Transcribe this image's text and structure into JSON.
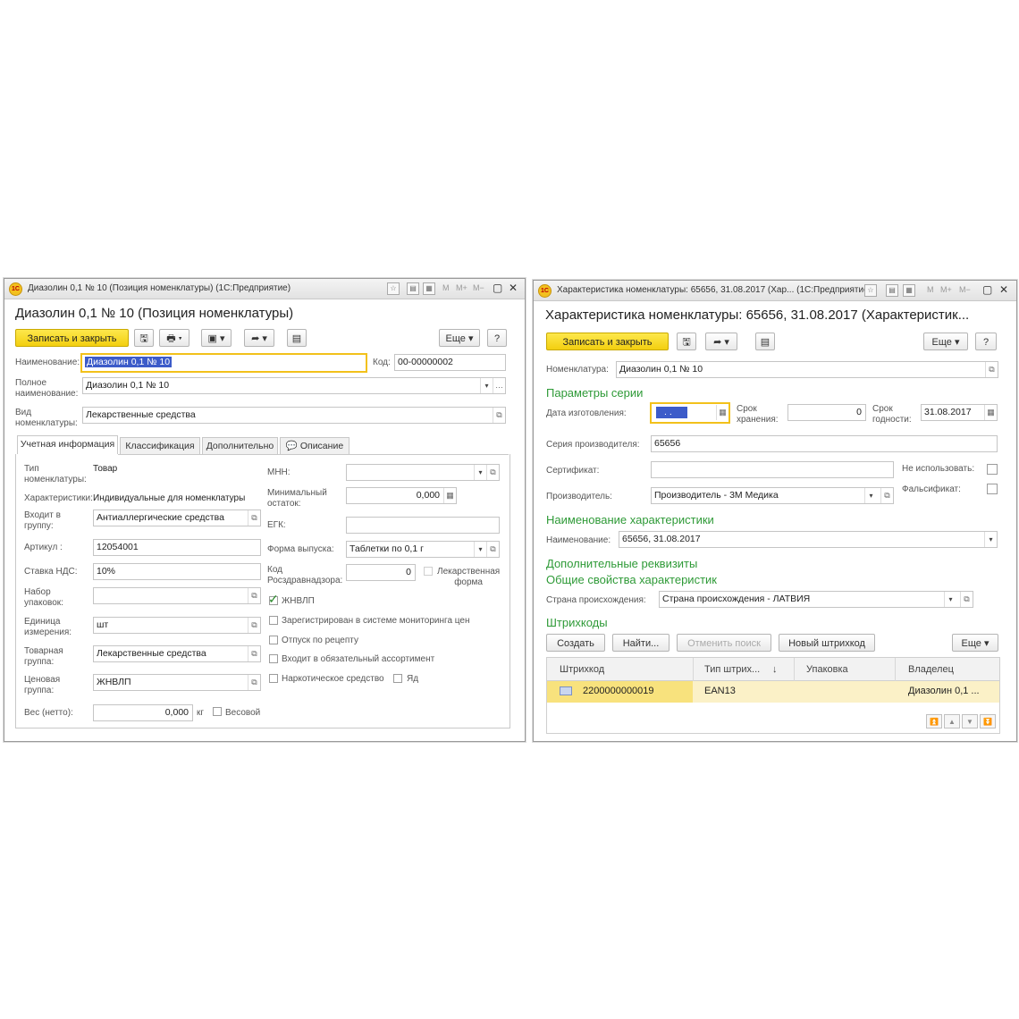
{
  "left": {
    "window_title": "Диазолин 0,1 № 10 (Позиция номенклатуры) (1С:Предприятие)",
    "form_title": "Диазолин 0,1 № 10 (Позиция номенклатуры)",
    "toolbar": {
      "save_close": "Записать и закрыть",
      "more": "Еще",
      "help": "?"
    },
    "fields": {
      "name_label": "Наименование:",
      "name_value": "Диазолин 0,1 № 10",
      "code_label": "Код:",
      "code_value": "00-00000002",
      "full_name_label_1": "Полное",
      "full_name_label_2": "наименование:",
      "full_name_value": "Диазолин 0,1 № 10",
      "kind_label_1": "Вид",
      "kind_label_2": "номенклатуры:",
      "kind_value": "Лекарственные средства"
    },
    "tabs": [
      "Учетная информация",
      "Классификация",
      "Дополнительно",
      "Описание"
    ],
    "account": {
      "type_label_1": "Тип",
      "type_label_2": "номенклатуры:",
      "type_value": "Товар",
      "char_label": "Характеристики:",
      "char_value": "Индивидуальные для номенклатуры",
      "group_label_1": "Входит в",
      "group_label_2": "группу:",
      "group_value": "Антиаллергические средства",
      "article_label": "Артикул :",
      "article_value": "12054001",
      "vat_label": "Ставка НДС:",
      "vat_value": "10%",
      "pack_label_1": "Набор",
      "pack_label_2": "упаковок:",
      "pack_value": "",
      "unit_label_1": "Единица",
      "unit_label_2": "измерения:",
      "unit_value": "шт",
      "goods_label_1": "Товарная",
      "goods_label_2": "группа:",
      "goods_value": "Лекарственные средства",
      "price_label_1": "Ценовая",
      "price_label_2": "группа:",
      "price_value": "ЖНВЛП",
      "weight_label": "Вес (нетто):",
      "weight_value": "0,000",
      "weight_unit": "кг",
      "weight_check": "Весовой",
      "mnn_label": "МНН:",
      "mnn_value": "",
      "min_label_1": "Минимальный",
      "min_label_2": "остаток:",
      "min_value": "0,000",
      "egk_label": "ЕГК:",
      "egk_value": "",
      "form_label": "Форма выпуска:",
      "form_value": "Таблетки по 0,1 г",
      "rzn_label_1": "Код",
      "rzn_label_2": "Росздравнадзора:",
      "rzn_value": "0",
      "drug_form_1": "Лекарственная",
      "drug_form_2": "форма",
      "zhnvlp": "ЖНВЛП",
      "monitor": "Зарегистрирован в системе мониторинга цен",
      "recipe": "Отпуск по рецепту",
      "assort": "Входит в обязательный ассортимент",
      "narcotic": "Наркотическое средство",
      "poison": "Яд"
    }
  },
  "right": {
    "window_title": "Характеристика номенклатуры: 65656, 31.08.2017 (Хар... (1С:Предприятие)",
    "form_title": "Характеристика номенклатуры: 65656, 31.08.2017 (Характеристик...",
    "toolbar": {
      "save_close": "Записать и закрыть",
      "more": "Еще",
      "help": "?"
    },
    "nom_label": "Номенклатура:",
    "nom_value": "Диазолин 0,1 № 10",
    "series_group": "Параметры серии",
    "made_label": "Дата изготовления:",
    "made_value": ". .",
    "storage_label_1": "Срок",
    "storage_label_2": "хранения:",
    "storage_value": "0",
    "expiry_label_1": "Срок",
    "expiry_label_2": "годности:",
    "expiry_value": "31.08.2017",
    "serial_label": "Серия производителя:",
    "serial_value": "65656",
    "cert_label": "Сертификат:",
    "cert_value": "",
    "not_use": "Не использовать:",
    "maker_label": "Производитель:",
    "maker_value": "Производитель - 3M Медика",
    "fake": "Фальсификат:",
    "char_name_group": "Наименование характеристики",
    "char_name_label": "Наименование:",
    "char_name_value": "65656, 31.08.2017",
    "extra_group": "Дополнительные реквизиты",
    "common_group": "Общие свойства характеристик",
    "country_label": "Страна происхождения:",
    "country_value": "Страна происхождения -  ЛАТВИЯ",
    "barcodes_group": "Штрихкоды",
    "barcode_buttons": {
      "create": "Создать",
      "find": "Найти...",
      "cancel_search": "Отменить поиск",
      "new_barcode": "Новый штрихкод",
      "more": "Еще"
    },
    "grid_headers": [
      "Штрихкод",
      "Тип штрих...",
      "↓",
      "Упаковка",
      "Владелец"
    ],
    "grid_row": {
      "barcode": "2200000000019",
      "type": "EAN13",
      "pack": "",
      "owner": "Диазолин 0,1 ..."
    }
  }
}
